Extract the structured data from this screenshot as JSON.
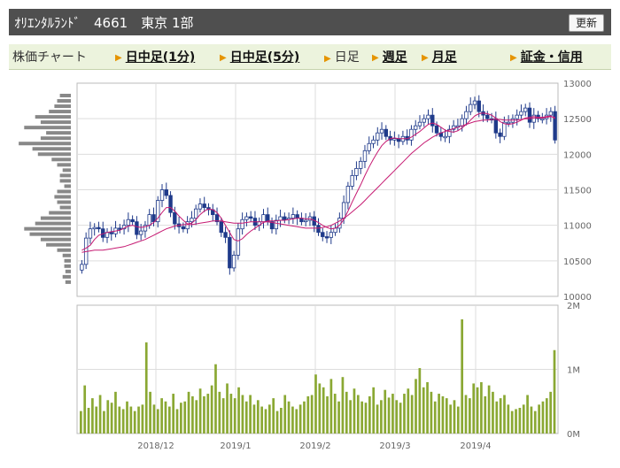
{
  "header": {
    "title": "ｵﾘｴﾝﾀﾙﾗﾝﾄﾞ　4661　東京 1部",
    "refresh_label": "更新"
  },
  "tabs": {
    "chart_label": "株価チャート",
    "intraday_1min": "日中足(1分)",
    "intraday_5min": "日中足(5分)",
    "daily": "日足",
    "weekly": "週足",
    "monthly": "月足",
    "margin": "証金・信用"
  },
  "colors": {
    "candle_up": "#ffffff",
    "candle_down": "#1f3a8a",
    "ma_short": "#c61a72",
    "ma_long": "#c61a72",
    "volume": "#8aa833",
    "profile": "#888888"
  },
  "chart_data": [
    {
      "type": "candlestick",
      "y_axis": {
        "ticks": [
          "13000",
          "12500",
          "12000",
          "11500",
          "11000",
          "10500",
          "10000"
        ],
        "ylim": [
          10000,
          13000
        ]
      },
      "x_axis": {
        "ticks": [
          "2018/12",
          "2019/1",
          "2019/2",
          "2019/3",
          "2019/4"
        ]
      },
      "grid": true,
      "close": [
        10450,
        10820,
        10950,
        10970,
        10950,
        10830,
        10900,
        10880,
        10960,
        10950,
        11000,
        11080,
        11050,
        10870,
        10920,
        11000,
        11150,
        11050,
        11350,
        11500,
        11420,
        11180,
        11020,
        10980,
        10950,
        11050,
        11100,
        11230,
        11300,
        11250,
        11220,
        11150,
        11050,
        10900,
        10830,
        10400,
        10580,
        10950,
        11080,
        11120,
        11100,
        11000,
        11050,
        11150,
        11050,
        10950,
        11070,
        11120,
        11080,
        11100,
        11150,
        11100,
        11050,
        11070,
        11120,
        11000,
        10900,
        10840,
        10830,
        10900,
        10960,
        11100,
        11320,
        11550,
        11700,
        11800,
        11900,
        12050,
        12150,
        12200,
        12300,
        12350,
        12250,
        12200,
        12220,
        12180,
        12250,
        12200,
        12350,
        12400,
        12450,
        12500,
        12550,
        12400,
        12300,
        12250,
        12250,
        12350,
        12400,
        12400,
        12500,
        12600,
        12700,
        12750,
        12600,
        12550,
        12500,
        12500,
        12300,
        12250,
        12450,
        12450,
        12500,
        12550,
        12600,
        12650,
        12450,
        12550,
        12500,
        12500,
        12550,
        12600,
        12200
      ],
      "ma_short": [
        10650,
        10680,
        10720,
        10800,
        10860,
        10880,
        10900,
        10910,
        10920,
        10930,
        10960,
        10990,
        11000,
        10980,
        10970,
        10980,
        11000,
        11040,
        11100,
        11180,
        11250,
        11250,
        11200,
        11130,
        11070,
        11020,
        11030,
        11080,
        11150,
        11200,
        11230,
        11220,
        11180,
        11100,
        11000,
        10900,
        10800,
        10780,
        10810,
        10870,
        10920,
        10960,
        11000,
        11040,
        11060,
        11060,
        11060,
        11070,
        11070,
        11080,
        11090,
        11100,
        11100,
        11090,
        11090,
        11070,
        11040,
        11000,
        10970,
        10950,
        10960,
        11000,
        11080,
        11200,
        11330,
        11450,
        11570,
        11700,
        11820,
        11930,
        12030,
        12120,
        12180,
        12220,
        12230,
        12220,
        12220,
        12220,
        12240,
        12280,
        12320,
        12370,
        12420,
        12440,
        12420,
        12380,
        12340,
        12320,
        12310,
        12330,
        12370,
        12420,
        12480,
        12540,
        12570,
        12580,
        12570,
        12550,
        12510,
        12460,
        12430,
        12420,
        12430,
        12450,
        12480,
        12510,
        12520,
        12530,
        12520,
        12520,
        12530,
        12540,
        12500
      ],
      "ma_long": [
        10620,
        10630,
        10640,
        10650,
        10650,
        10650,
        10660,
        10670,
        10680,
        10690,
        10700,
        10720,
        10740,
        10760,
        10780,
        10800,
        10830,
        10860,
        10890,
        10920,
        10950,
        10970,
        10990,
        11000,
        11010,
        11010,
        11010,
        11020,
        11030,
        11040,
        11050,
        11060,
        11060,
        11060,
        11050,
        11040,
        11030,
        11030,
        11030,
        11040,
        11050,
        11050,
        11050,
        11050,
        11050,
        11040,
        11030,
        11020,
        11010,
        11000,
        10990,
        10980,
        10970,
        10960,
        10960,
        10960,
        10960,
        10970,
        10980,
        11000,
        11030,
        11060,
        11100,
        11140,
        11190,
        11240,
        11290,
        11350,
        11410,
        11470,
        11530,
        11590,
        11650,
        11710,
        11770,
        11830,
        11890,
        11950,
        12010,
        12060,
        12110,
        12160,
        12200,
        12240,
        12270,
        12300,
        12320,
        12340,
        12360,
        12380,
        12400,
        12420,
        12440,
        12460,
        12470,
        12480,
        12480,
        12490,
        12490,
        12490,
        12480,
        12480,
        12480,
        12480,
        12490,
        12500,
        12500,
        12510,
        12510,
        12510,
        12520,
        12530,
        12520
      ],
      "price_profile": [
        0.2,
        0.25,
        0.3,
        0.4,
        0.65,
        0.55,
        0.85,
        0.45,
        0.55,
        0.95,
        0.7,
        0.6,
        0.35,
        0.25,
        0.15,
        0.2,
        0.2,
        0.12,
        0.25,
        0.3,
        0.25,
        0.2,
        0.4,
        0.55,
        0.65,
        0.85,
        0.75,
        0.55,
        0.45,
        0.25,
        0.15,
        0.12,
        0.12,
        0.1,
        0.15,
        0.1
      ]
    },
    {
      "type": "bar",
      "y_axis": {
        "ticks": [
          "2M",
          "1M",
          "0M"
        ],
        "ylim": [
          0,
          2000000
        ]
      },
      "x_axis": {
        "ticks": [
          "2018/12",
          "2019/1",
          "2019/2",
          "2019/3",
          "2019/4"
        ]
      },
      "values": [
        350000,
        750000,
        400000,
        550000,
        420000,
        600000,
        350000,
        520000,
        480000,
        650000,
        420000,
        380000,
        500000,
        420000,
        350000,
        420000,
        450000,
        1420000,
        650000,
        450000,
        380000,
        550000,
        500000,
        420000,
        620000,
        380000,
        480000,
        500000,
        650000,
        580000,
        520000,
        700000,
        580000,
        620000,
        750000,
        1080000,
        650000,
        550000,
        780000,
        620000,
        550000,
        720000,
        600000,
        500000,
        600000,
        450000,
        520000,
        420000,
        380000,
        450000,
        550000,
        350000,
        400000,
        600000,
        500000,
        420000,
        380000,
        450000,
        500000,
        580000,
        600000,
        920000,
        780000,
        720000,
        580000,
        850000,
        620000,
        500000,
        880000,
        650000,
        520000,
        700000,
        600000,
        500000,
        480000,
        580000,
        720000,
        450000,
        520000,
        680000,
        560000,
        620000,
        520000,
        480000,
        620000,
        700000,
        600000,
        850000,
        1020000,
        720000,
        800000,
        650000,
        500000,
        620000,
        580000,
        550000,
        450000,
        520000,
        420000,
        1780000,
        600000,
        550000,
        780000,
        720000,
        800000,
        580000,
        750000,
        650000,
        500000,
        550000,
        600000,
        450000,
        350000,
        380000,
        400000,
        450000,
        600000,
        420000,
        350000,
        450000,
        500000,
        550000,
        650000,
        1300000
      ]
    }
  ]
}
